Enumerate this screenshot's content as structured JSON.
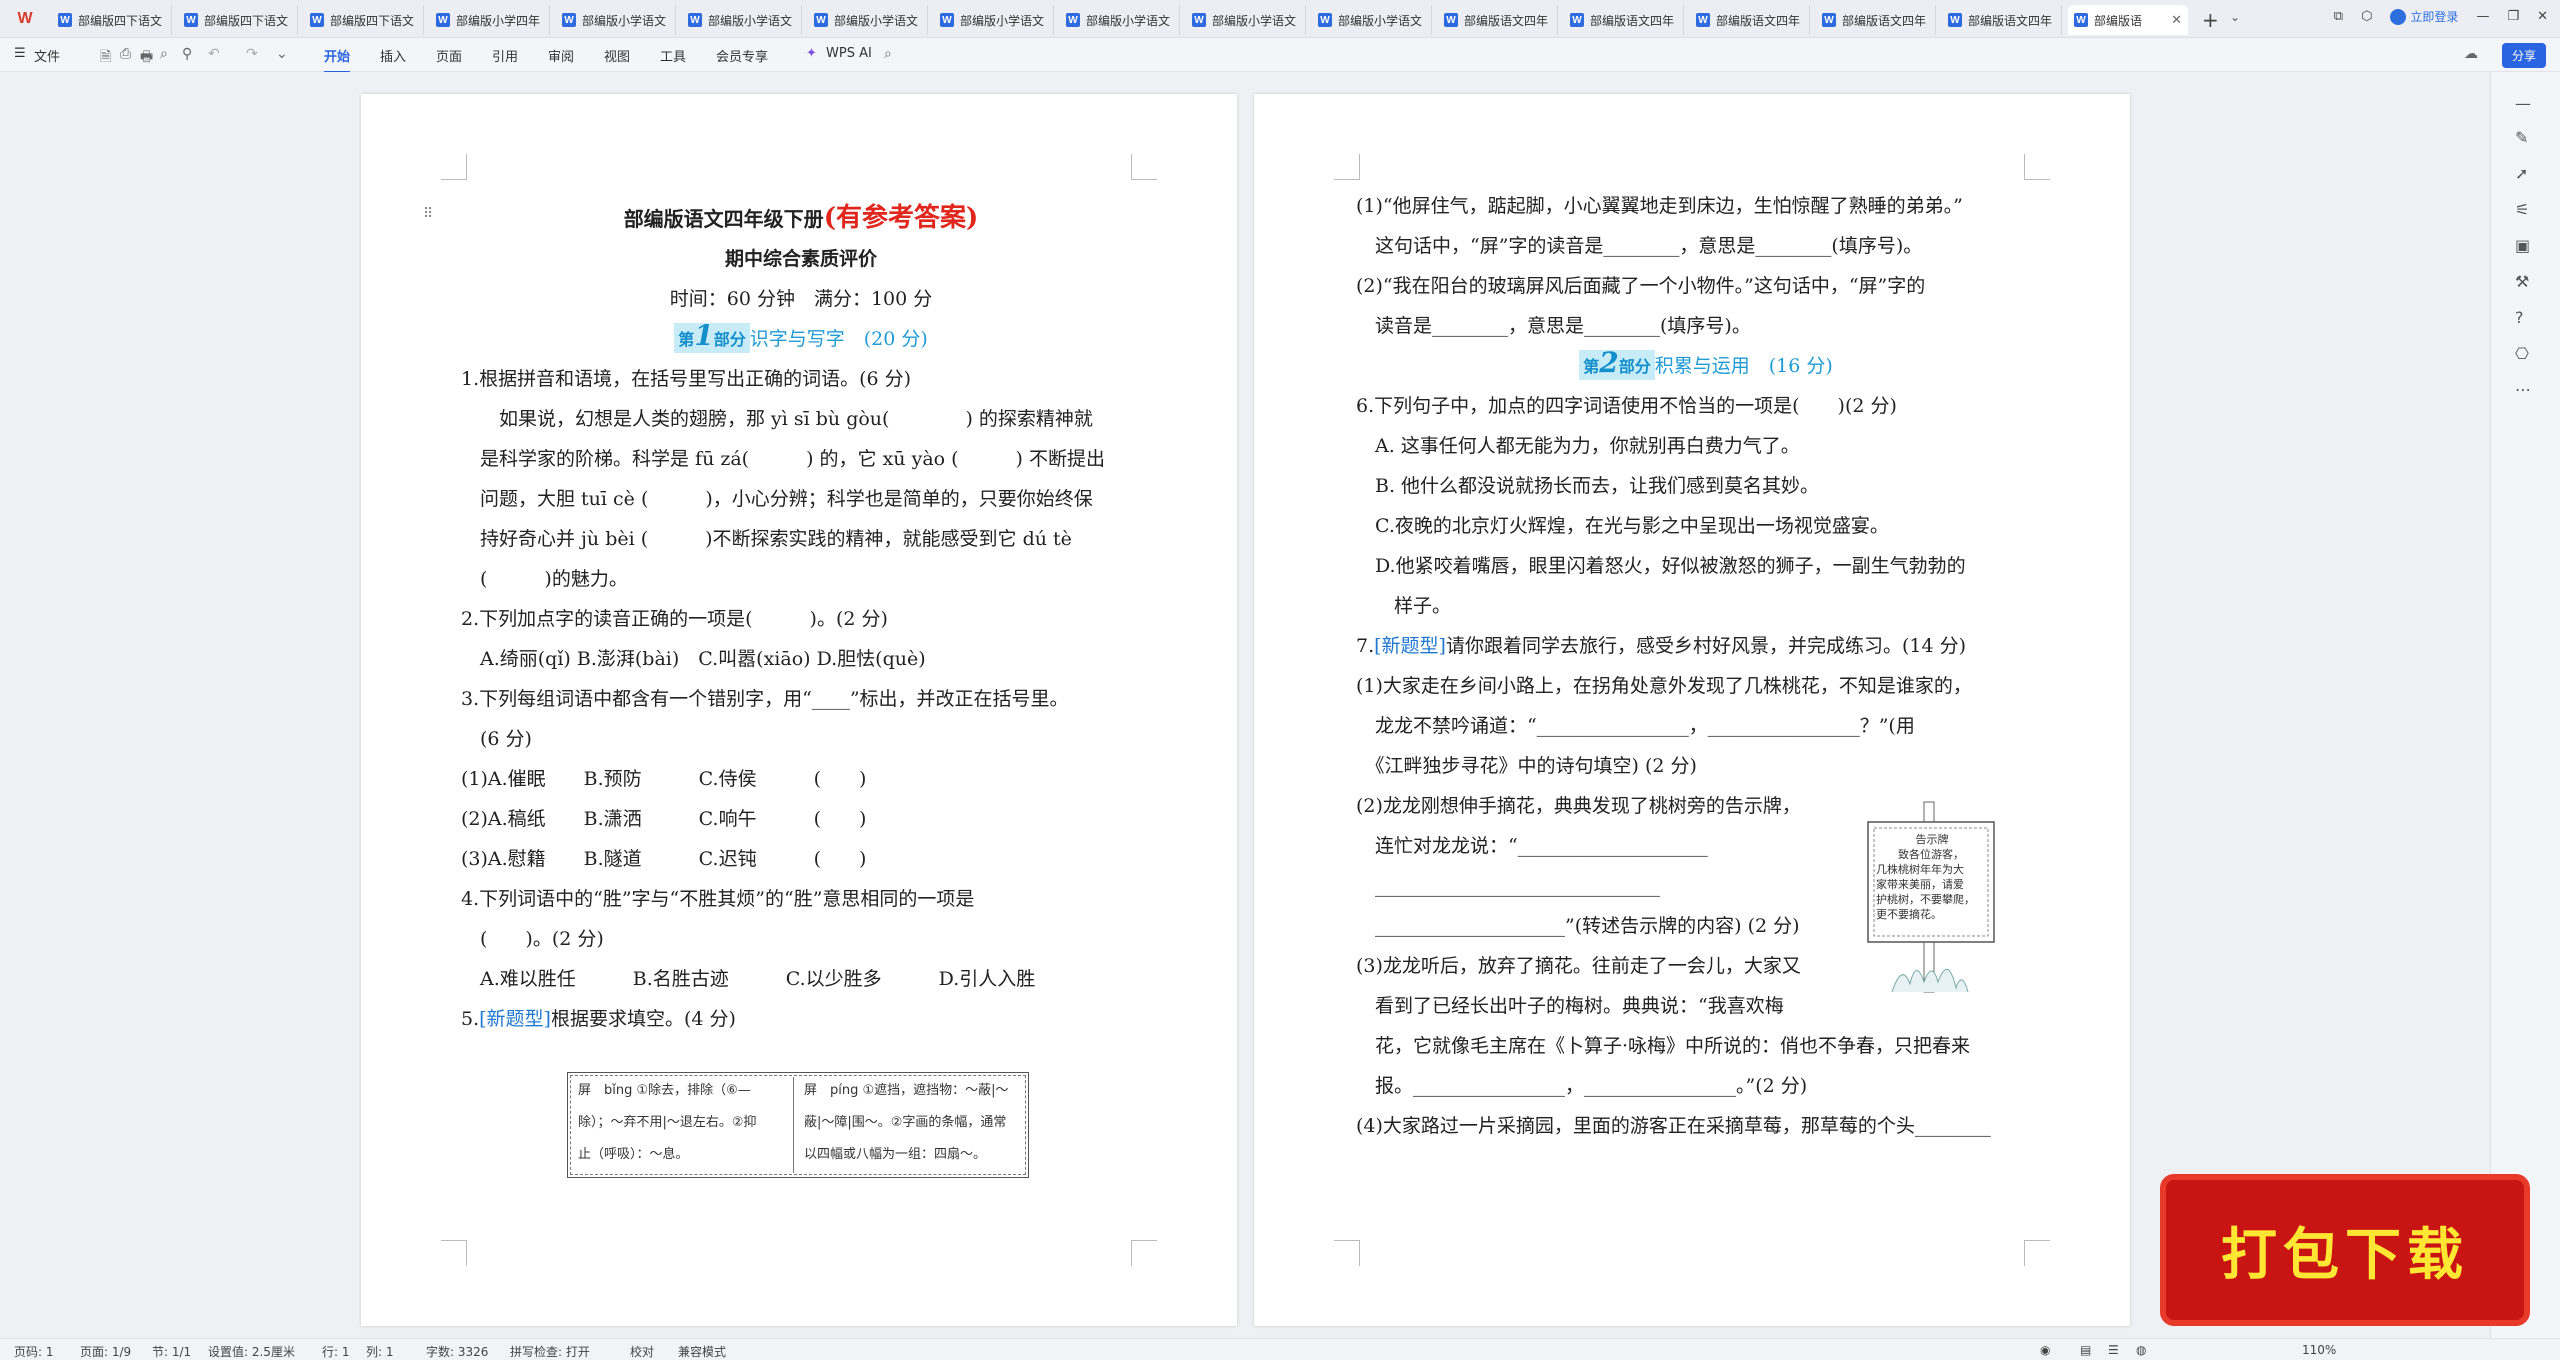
{
  "app": {
    "logo": "W"
  },
  "tabs": [
    "部编版四下语文",
    "部编版四下语文",
    "部编版四下语文",
    "部编版小学四年",
    "部编版小学语文",
    "部编版小学语文",
    "部编版小学语文",
    "部编版小学语文",
    "部编版小学语文",
    "部编版小学语文",
    "部编版小学语文",
    "部编版语文四年",
    "部编版语文四年",
    "部编版语文四年",
    "部编版语文四年",
    "部编版语文四年",
    "部编版语"
  ],
  "tab_icon": "W",
  "topbar": {
    "login": "立即登录",
    "share": "分享"
  },
  "toolbar": {
    "file": "文件",
    "tabs": [
      "开始",
      "插入",
      "页面",
      "引用",
      "审阅",
      "视图",
      "工具",
      "会员专享"
    ],
    "wps_ai": "WPS AI"
  },
  "doc": {
    "title": "部编版语文四年级下册",
    "title_red": "(有参考答案)",
    "subtitle": "期中综合素质评价",
    "meta": "时间：60 分钟　满分：100 分",
    "part1": {
      "pre": "第",
      "num": "1",
      "post": "部分",
      "name": "识字与写字　(20 分)"
    },
    "p1_lines": [
      "1.根据拼音和语境，在括号里写出正确的词语。(6 分)",
      "　　如果说，幻想是人类的翅膀，那 yì sī bù gòu(　　　　) 的探索精神就",
      "　是科学家的阶梯。科学是 fū zá(　　　) 的，它  xū yào (　　　) 不断提出",
      "　问题，大胆 tuī cè (　　　)，小心分辨；科学也是简单的，只要你始终保",
      "　持好奇心并 jù bèi (　　　)不断探索实践的精神，就能感受到它  dú tè",
      "　(　　　)的魅力。",
      "2.下列加点字的读音正确的一项是(　　　)。(2 分)",
      "　A.绮丽(qǐ)  B.澎湃(bài)　C.叫嚣(xiāo)  D.胆怯(què)",
      "3.下列每组词语中都含有一个错别字，用“____”标出，并改正在括号里。",
      "　(6 分)",
      "(1)A.催眠　　B.预防　　　C.侍侯　　　(　　)",
      "(2)A.稿纸　　B.潇洒　　　C.响午　　　(　　)",
      "(3)A.慰籍　　B.隧道　　　C.迟钝　　　(　　)",
      "4.下列词语中的“胜”字与“不胜其烦”的“胜”意思相同的一项是",
      "　(　　)。(2 分)",
      "　A.难以胜任　　　B.名胜古迹　　　C.以少胜多　　　D.引人入胜"
    ],
    "q5": {
      "num": "5.",
      "tag": "[新题型]",
      "text": "根据要求填空。(4 分)"
    },
    "dict_left": [
      "屏　bǐng ①除去，排除（⑥—",
      "除）；～弃不用|～退左右。②抑",
      "止（呼吸）：～息。"
    ],
    "dict_right": [
      "屏　píng ①遮挡，遮挡物：～蔽|～",
      "蔽|～障|围～。②字画的条幅，通常",
      "以四幅或八幅为一组：四扇～。"
    ],
    "p2_lines_a": [
      "(1)“他屏住气，踮起脚，小心翼翼地走到床边，生怕惊醒了熟睡的弟弟。”",
      "　这句话中，“屏”字的读音是________，意思是________(填序号)。",
      "(2)“我在阳台的玻璃屏风后面藏了一个小物件。”这句话中，“屏”字的",
      "　读音是________，意思是________(填序号)。"
    ],
    "part2": {
      "pre": "第",
      "num": "2",
      "post": "部分",
      "name": "积累与运用　(16 分)"
    },
    "p2_lines_b": [
      "6.下列句子中，加点的四字词语使用不恰当的一项是(　　)(2 分)",
      "　A. 这事任何人都无能为力，你就别再白费力气了。",
      "　B. 他什么都没说就扬长而去，让我们感到莫名其妙。",
      "　C.夜晚的北京灯火辉煌，在光与影之中呈现出一场视觉盛宴。",
      "　D.他紧咬着嘴唇，眼里闪着怒火，好似被激怒的狮子，一副生气勃勃的",
      "　　样子。"
    ],
    "q7": {
      "num": "7.",
      "tag": "[新题型]",
      "text": "请你跟着同学去旅行，感受乡村好风景，并完成练习。(14 分)"
    },
    "p2_lines_c": [
      "(1)大家走在乡间小路上，在拐角处意外发现了几株桃花，不知是谁家的，",
      "　龙龙不禁吟诵道：“________________，________________？”(用",
      "　《江畔独步寻花》中的诗句填空) (2 分)",
      "(2)龙龙刚想伸手摘花，典典发现了桃树旁的告示牌，",
      "　连忙对龙龙说：“____________________",
      "　______________________________",
      "　____________________”(转述告示牌的内容) (2 分)",
      "(3)龙龙听后，放弃了摘花。往前走了一会儿，大家又",
      "　看到了已经长出叶子的梅树。典典说：“我喜欢梅",
      "　花，它就像毛主席在《卜算子·咏梅》中所说的：俏也不争春，只把春来",
      "　报。________________，________________。”(2 分)",
      "(4)大家路过一片采摘园，里面的游客正在采摘草莓，那草莓的个头________"
    ],
    "sign": {
      "title": "告示牌",
      "text": [
        "　　致各位游客，",
        "几株桃树年年为大",
        "家带来美丽，请爱",
        "护桃树，不要攀爬，",
        "更不要摘花。"
      ]
    }
  },
  "statusbar": {
    "page": "页码: 1",
    "pages": "页面: 1/9",
    "section": "节: 1/1",
    "setting": "设置值: 2.5厘米",
    "row": "行: 1",
    "col": "列: 1",
    "words": "字数: 3326",
    "spell": "拼写检查: 打开",
    "proof": "校对",
    "compat": "兼容模式",
    "zoom": "110%"
  },
  "promo": {
    "text": "打包下载"
  }
}
